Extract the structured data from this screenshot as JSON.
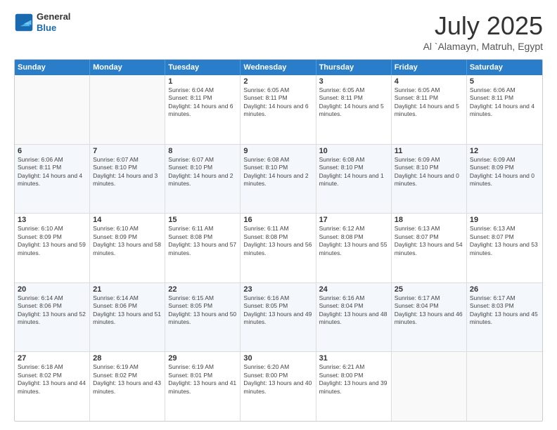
{
  "header": {
    "logo": {
      "general": "General",
      "blue": "Blue"
    },
    "title": "July 2025",
    "location": "Al `Alamayn, Matruh, Egypt"
  },
  "calendar": {
    "days_of_week": [
      "Sunday",
      "Monday",
      "Tuesday",
      "Wednesday",
      "Thursday",
      "Friday",
      "Saturday"
    ],
    "rows": [
      [
        {
          "day": "",
          "empty": true
        },
        {
          "day": "",
          "empty": true
        },
        {
          "day": "1",
          "sunrise": "Sunrise: 6:04 AM",
          "sunset": "Sunset: 8:11 PM",
          "daylight": "Daylight: 14 hours and 6 minutes."
        },
        {
          "day": "2",
          "sunrise": "Sunrise: 6:05 AM",
          "sunset": "Sunset: 8:11 PM",
          "daylight": "Daylight: 14 hours and 6 minutes."
        },
        {
          "day": "3",
          "sunrise": "Sunrise: 6:05 AM",
          "sunset": "Sunset: 8:11 PM",
          "daylight": "Daylight: 14 hours and 5 minutes."
        },
        {
          "day": "4",
          "sunrise": "Sunrise: 6:05 AM",
          "sunset": "Sunset: 8:11 PM",
          "daylight": "Daylight: 14 hours and 5 minutes."
        },
        {
          "day": "5",
          "sunrise": "Sunrise: 6:06 AM",
          "sunset": "Sunset: 8:11 PM",
          "daylight": "Daylight: 14 hours and 4 minutes."
        }
      ],
      [
        {
          "day": "6",
          "sunrise": "Sunrise: 6:06 AM",
          "sunset": "Sunset: 8:11 PM",
          "daylight": "Daylight: 14 hours and 4 minutes."
        },
        {
          "day": "7",
          "sunrise": "Sunrise: 6:07 AM",
          "sunset": "Sunset: 8:10 PM",
          "daylight": "Daylight: 14 hours and 3 minutes."
        },
        {
          "day": "8",
          "sunrise": "Sunrise: 6:07 AM",
          "sunset": "Sunset: 8:10 PM",
          "daylight": "Daylight: 14 hours and 2 minutes."
        },
        {
          "day": "9",
          "sunrise": "Sunrise: 6:08 AM",
          "sunset": "Sunset: 8:10 PM",
          "daylight": "Daylight: 14 hours and 2 minutes."
        },
        {
          "day": "10",
          "sunrise": "Sunrise: 6:08 AM",
          "sunset": "Sunset: 8:10 PM",
          "daylight": "Daylight: 14 hours and 1 minute."
        },
        {
          "day": "11",
          "sunrise": "Sunrise: 6:09 AM",
          "sunset": "Sunset: 8:10 PM",
          "daylight": "Daylight: 14 hours and 0 minutes."
        },
        {
          "day": "12",
          "sunrise": "Sunrise: 6:09 AM",
          "sunset": "Sunset: 8:09 PM",
          "daylight": "Daylight: 14 hours and 0 minutes."
        }
      ],
      [
        {
          "day": "13",
          "sunrise": "Sunrise: 6:10 AM",
          "sunset": "Sunset: 8:09 PM",
          "daylight": "Daylight: 13 hours and 59 minutes."
        },
        {
          "day": "14",
          "sunrise": "Sunrise: 6:10 AM",
          "sunset": "Sunset: 8:09 PM",
          "daylight": "Daylight: 13 hours and 58 minutes."
        },
        {
          "day": "15",
          "sunrise": "Sunrise: 6:11 AM",
          "sunset": "Sunset: 8:08 PM",
          "daylight": "Daylight: 13 hours and 57 minutes."
        },
        {
          "day": "16",
          "sunrise": "Sunrise: 6:11 AM",
          "sunset": "Sunset: 8:08 PM",
          "daylight": "Daylight: 13 hours and 56 minutes."
        },
        {
          "day": "17",
          "sunrise": "Sunrise: 6:12 AM",
          "sunset": "Sunset: 8:08 PM",
          "daylight": "Daylight: 13 hours and 55 minutes."
        },
        {
          "day": "18",
          "sunrise": "Sunrise: 6:13 AM",
          "sunset": "Sunset: 8:07 PM",
          "daylight": "Daylight: 13 hours and 54 minutes."
        },
        {
          "day": "19",
          "sunrise": "Sunrise: 6:13 AM",
          "sunset": "Sunset: 8:07 PM",
          "daylight": "Daylight: 13 hours and 53 minutes."
        }
      ],
      [
        {
          "day": "20",
          "sunrise": "Sunrise: 6:14 AM",
          "sunset": "Sunset: 8:06 PM",
          "daylight": "Daylight: 13 hours and 52 minutes."
        },
        {
          "day": "21",
          "sunrise": "Sunrise: 6:14 AM",
          "sunset": "Sunset: 8:06 PM",
          "daylight": "Daylight: 13 hours and 51 minutes."
        },
        {
          "day": "22",
          "sunrise": "Sunrise: 6:15 AM",
          "sunset": "Sunset: 8:05 PM",
          "daylight": "Daylight: 13 hours and 50 minutes."
        },
        {
          "day": "23",
          "sunrise": "Sunrise: 6:16 AM",
          "sunset": "Sunset: 8:05 PM",
          "daylight": "Daylight: 13 hours and 49 minutes."
        },
        {
          "day": "24",
          "sunrise": "Sunrise: 6:16 AM",
          "sunset": "Sunset: 8:04 PM",
          "daylight": "Daylight: 13 hours and 48 minutes."
        },
        {
          "day": "25",
          "sunrise": "Sunrise: 6:17 AM",
          "sunset": "Sunset: 8:04 PM",
          "daylight": "Daylight: 13 hours and 46 minutes."
        },
        {
          "day": "26",
          "sunrise": "Sunrise: 6:17 AM",
          "sunset": "Sunset: 8:03 PM",
          "daylight": "Daylight: 13 hours and 45 minutes."
        }
      ],
      [
        {
          "day": "27",
          "sunrise": "Sunrise: 6:18 AM",
          "sunset": "Sunset: 8:02 PM",
          "daylight": "Daylight: 13 hours and 44 minutes."
        },
        {
          "day": "28",
          "sunrise": "Sunrise: 6:19 AM",
          "sunset": "Sunset: 8:02 PM",
          "daylight": "Daylight: 13 hours and 43 minutes."
        },
        {
          "day": "29",
          "sunrise": "Sunrise: 6:19 AM",
          "sunset": "Sunset: 8:01 PM",
          "daylight": "Daylight: 13 hours and 41 minutes."
        },
        {
          "day": "30",
          "sunrise": "Sunrise: 6:20 AM",
          "sunset": "Sunset: 8:00 PM",
          "daylight": "Daylight: 13 hours and 40 minutes."
        },
        {
          "day": "31",
          "sunrise": "Sunrise: 6:21 AM",
          "sunset": "Sunset: 8:00 PM",
          "daylight": "Daylight: 13 hours and 39 minutes."
        },
        {
          "day": "",
          "empty": true
        },
        {
          "day": "",
          "empty": true
        }
      ]
    ]
  }
}
